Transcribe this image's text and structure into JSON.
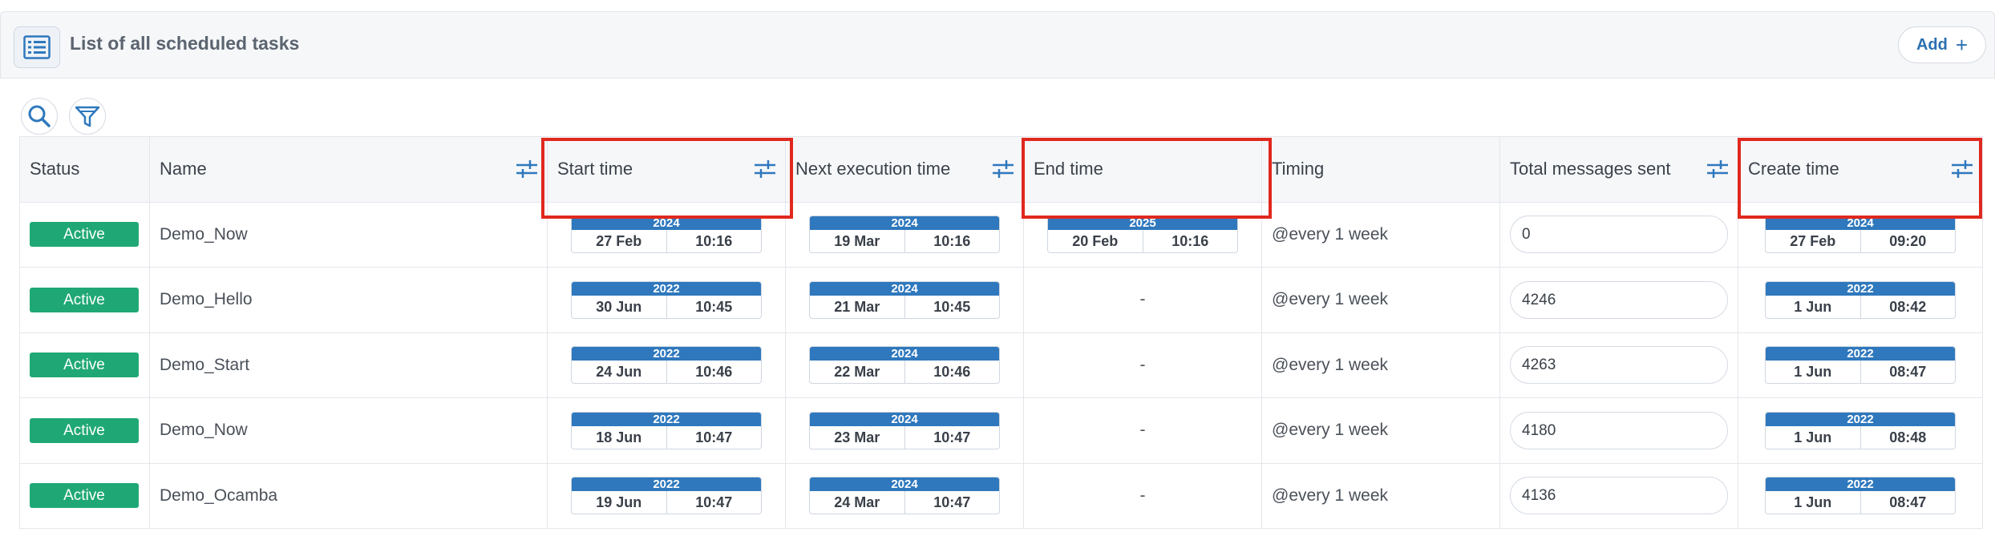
{
  "header": {
    "title": "List of all scheduled tasks",
    "add_label": "Add",
    "add_symbol": "+"
  },
  "toolbar": {
    "icons": [
      "search-icon",
      "filter-icon"
    ]
  },
  "columns": {
    "status": "Status",
    "name": "Name",
    "start_time": "Start time",
    "next_execution_time": "Next execution time",
    "end_time": "End time",
    "timing": "Timing",
    "total_messages_sent": "Total messages sent",
    "create_time": "Create time"
  },
  "rows": [
    {
      "status": "Active",
      "name": "Demo_Now",
      "start": {
        "year": "2024",
        "day": "27 Feb",
        "time": "10:16"
      },
      "next": {
        "year": "2024",
        "day": "19 Mar",
        "time": "10:16"
      },
      "end": {
        "year": "2025",
        "day": "20 Feb",
        "time": "10:16"
      },
      "timing": "@every 1 week",
      "total": "0",
      "create": {
        "year": "2024",
        "day": "27 Feb",
        "time": "09:20"
      }
    },
    {
      "status": "Active",
      "name": "Demo_Hello",
      "start": {
        "year": "2022",
        "day": "30 Jun",
        "time": "10:45"
      },
      "next": {
        "year": "2024",
        "day": "21 Mar",
        "time": "10:45"
      },
      "end_text": "-",
      "timing": "@every 1 week",
      "total": "4246",
      "create": {
        "year": "2022",
        "day": "1 Jun",
        "time": "08:42"
      }
    },
    {
      "status": "Active",
      "name": "Demo_Start",
      "start": {
        "year": "2022",
        "day": "24 Jun",
        "time": "10:46"
      },
      "next": {
        "year": "2024",
        "day": "22 Mar",
        "time": "10:46"
      },
      "end_text": "-",
      "timing": "@every 1 week",
      "total": "4263",
      "create": {
        "year": "2022",
        "day": "1 Jun",
        "time": "08:47"
      }
    },
    {
      "status": "Active",
      "name": "Demo_Now",
      "start": {
        "year": "2022",
        "day": "18 Jun",
        "time": "10:47"
      },
      "next": {
        "year": "2024",
        "day": "23 Mar",
        "time": "10:47"
      },
      "end_text": "-",
      "timing": "@every 1 week",
      "total": "4180",
      "create": {
        "year": "2022",
        "day": "1 Jun",
        "time": "08:48"
      }
    },
    {
      "status": "Active",
      "name": "Demo_Ocamba",
      "start": {
        "year": "2022",
        "day": "19 Jun",
        "time": "10:47"
      },
      "next": {
        "year": "2024",
        "day": "24 Mar",
        "time": "10:47"
      },
      "end_text": "-",
      "timing": "@every 1 week",
      "total": "4136",
      "create": {
        "year": "2022",
        "day": "1 Jun",
        "time": "08:47"
      }
    }
  ],
  "colors": {
    "accent": "#2f78bd",
    "status_active": "#1fa875",
    "highlight": "#e0281e"
  }
}
